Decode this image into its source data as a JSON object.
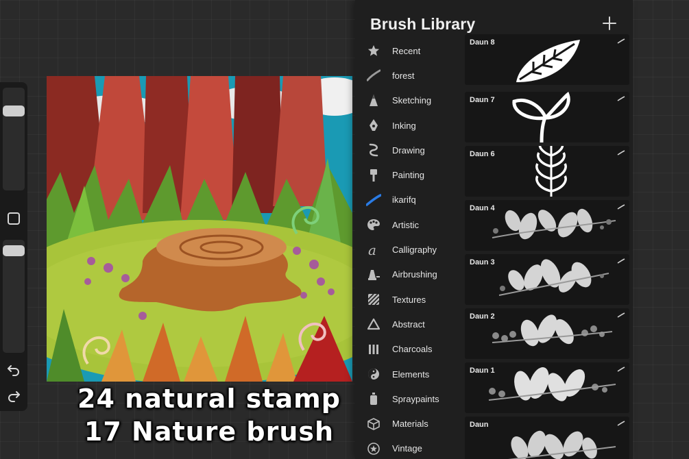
{
  "library": {
    "title": "Brush Library",
    "add_icon": "plus-icon",
    "sets": [
      {
        "label": "Recent",
        "icon": "star-icon"
      },
      {
        "label": "forest",
        "icon": "stroke-swoosh-icon"
      },
      {
        "label": "Sketching",
        "icon": "pencil-tip-icon"
      },
      {
        "label": "Inking",
        "icon": "pen-nib-icon"
      },
      {
        "label": "Drawing",
        "icon": "squiggle-icon"
      },
      {
        "label": "Painting",
        "icon": "paint-brush-icon"
      },
      {
        "label": "ikarifq",
        "icon": "blue-stroke-icon"
      },
      {
        "label": "Artistic",
        "icon": "palette-icon"
      },
      {
        "label": "Calligraphy",
        "icon": "calligraphy-a-icon"
      },
      {
        "label": "Airbrushing",
        "icon": "airbrush-icon"
      },
      {
        "label": "Textures",
        "icon": "texture-icon"
      },
      {
        "label": "Abstract",
        "icon": "triangle-icon"
      },
      {
        "label": "Charcoals",
        "icon": "charcoal-icon"
      },
      {
        "label": "Elements",
        "icon": "yin-yang-icon"
      },
      {
        "label": "Spraypaints",
        "icon": "spray-can-icon"
      },
      {
        "label": "Materials",
        "icon": "cube-icon"
      },
      {
        "label": "Vintage",
        "icon": "vintage-star-icon"
      }
    ],
    "brushes": [
      {
        "name": "Daun 8"
      },
      {
        "name": "Daun 7"
      },
      {
        "name": "Daun 6"
      },
      {
        "name": "Daun 4"
      },
      {
        "name": "Daun 3"
      },
      {
        "name": "Daun 2"
      },
      {
        "name": "Daun 1"
      },
      {
        "name": "Daun"
      }
    ]
  },
  "promo": {
    "line1": "24 natural stamp",
    "line2": "17 Nature brush"
  },
  "colors": {
    "panel_bg": "#1f1f1f",
    "active_set_accent": "#2a7be4",
    "sky": "#1a9ab4",
    "grass": "#a8c43a",
    "stump": "#b5652b"
  }
}
